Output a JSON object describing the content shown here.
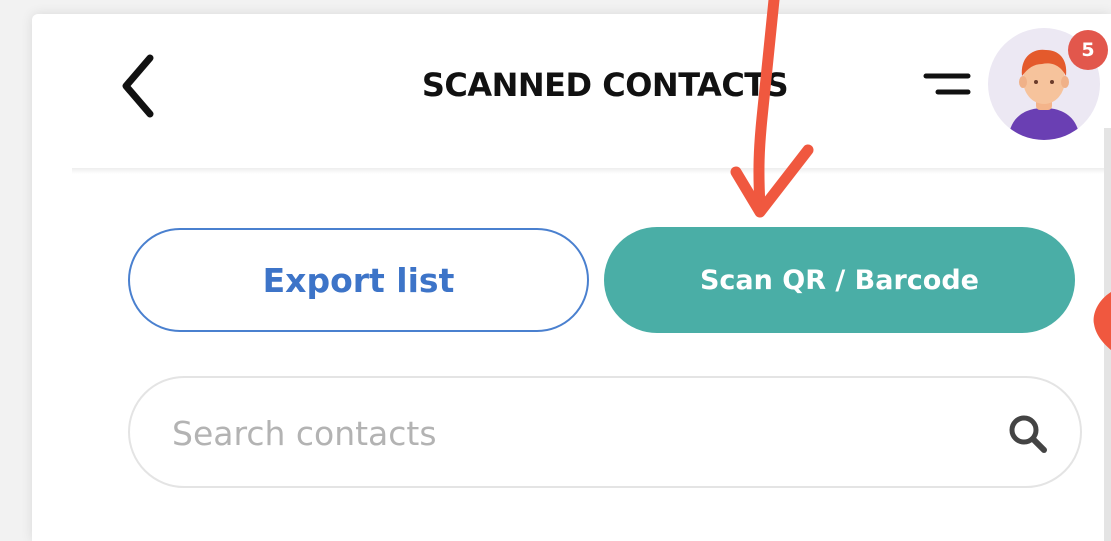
{
  "header": {
    "title": "SCANNED CONTACTS",
    "notification_count": "5"
  },
  "actions": {
    "export_label": "Export list",
    "scan_label": "Scan QR / Barcode"
  },
  "search": {
    "placeholder": "Search contacts",
    "value": ""
  },
  "icons": {
    "back": "chevron-left-icon",
    "menu": "menu-icon",
    "avatar": "user-avatar-icon",
    "search": "search-icon"
  },
  "colors": {
    "export_text": "#3d74c8",
    "export_border": "#4a80cf",
    "scan_background": "#4aaea6",
    "badge": "#e2574c",
    "annotation_arrow": "#f0583f"
  }
}
